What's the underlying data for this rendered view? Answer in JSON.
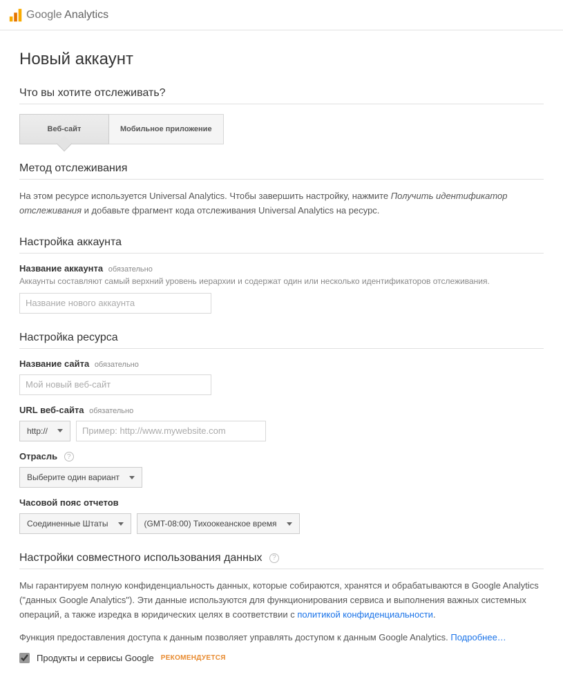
{
  "header": {
    "logo_text_left": "Google",
    "logo_text_right": "Analytics"
  },
  "page": {
    "title": "Новый аккаунт"
  },
  "track_what": {
    "heading": "Что вы хотите отслеживать?",
    "tab_website": "Веб-сайт",
    "tab_mobile": "Мобильное приложение"
  },
  "tracking_method": {
    "heading": "Метод отслеживания",
    "text_before": "На этом ресурсе используется Universal Analytics. Чтобы завершить настройку, нажмите ",
    "text_italic": "Получить идентификатор отслеживания",
    "text_after": " и добавьте фрагмент кода отслеживания Universal Analytics на ресурс."
  },
  "account_setup": {
    "heading": "Настройка аккаунта",
    "name_label": "Название аккаунта",
    "name_required": "обязательно",
    "name_help": "Аккаунты составляют самый верхний уровень иерархии и содержат один или несколько идентификаторов отслеживания.",
    "name_placeholder": "Название нового аккаунта"
  },
  "property_setup": {
    "heading": "Настройка ресурса",
    "site_name_label": "Название сайта",
    "site_name_required": "обязательно",
    "site_name_placeholder": "Мой новый веб-сайт",
    "url_label": "URL веб-сайта",
    "url_required": "обязательно",
    "protocol": "http://",
    "url_placeholder": "Пример: http://www.mywebsite.com",
    "industry_label": "Отрасль",
    "industry_value": "Выберите один вариант",
    "timezone_label": "Часовой пояс отчетов",
    "timezone_country": "Соединенные Штаты",
    "timezone_value": "(GMT-08:00) Тихоокеанское время"
  },
  "data_sharing": {
    "heading": "Настройки совместного использования данных",
    "intro_text": "Мы гарантируем полную конфиденциальность данных, которые собираются, хранятся и обрабатываются в Google Analytics (\"данных Google Analytics\"). Эти данные используются для функционирования сервиса и выполнения важных системных операций, а также изредка в юридических целях в соответствии с ",
    "privacy_link": "политикой конфиденциальности",
    "period": ".",
    "access_text": "Функция предоставления доступа к данным позволяет управлять доступом к данным Google Analytics. ",
    "more_link": "Подробнее…",
    "checkbox_label": "Продукты и сервисы Google",
    "recommended": "РЕКОМЕНДУЕТСЯ"
  }
}
